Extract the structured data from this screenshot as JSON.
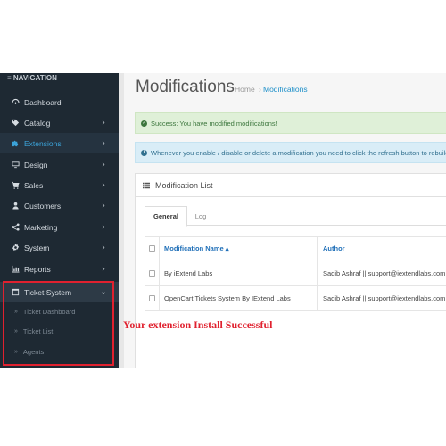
{
  "sidebar": {
    "heading": "≡ NAVIGATION",
    "items": [
      {
        "label": "Dashboard",
        "icon": "dashboard-icon",
        "has_arrow": false
      },
      {
        "label": "Catalog",
        "icon": "tag-icon",
        "has_arrow": true
      },
      {
        "label": "Extensions",
        "icon": "puzzle-icon",
        "has_arrow": true
      },
      {
        "label": "Design",
        "icon": "monitor-icon",
        "has_arrow": true
      },
      {
        "label": "Sales",
        "icon": "cart-icon",
        "has_arrow": true
      },
      {
        "label": "Customers",
        "icon": "user-icon",
        "has_arrow": true
      },
      {
        "label": "Marketing",
        "icon": "share-icon",
        "has_arrow": true
      },
      {
        "label": "System",
        "icon": "gear-icon",
        "has_arrow": true
      },
      {
        "label": "Reports",
        "icon": "bar-chart-icon",
        "has_arrow": true
      },
      {
        "label": "Ticket System",
        "icon": "ticket-icon",
        "has_arrow": true
      }
    ],
    "sub_items": [
      {
        "label": "Ticket Dashboard"
      },
      {
        "label": "Ticket List"
      },
      {
        "label": "Agents"
      }
    ],
    "chevron_right": "›",
    "chevron_down": "⌄",
    "sub_arrow": "»"
  },
  "header": {
    "title": "Modifications",
    "breadcrumb_home": "Home",
    "breadcrumb_sep": "›",
    "breadcrumb_current": "Modifications"
  },
  "alerts": {
    "success": "Success: You have modified modifications!",
    "success_icon": "check-circle-icon",
    "info": "Whenever you enable / disable or delete a modification you need to click the refresh button to rebuild",
    "info_icon": "info-circle-icon"
  },
  "panel": {
    "title": "Modification List",
    "icon": "list-icon",
    "tabs": [
      "General",
      "Log"
    ],
    "columns": [
      "Modification Name ▴",
      "Author"
    ],
    "rows": [
      {
        "name": "By iExtend Labs",
        "author": "Saqib Ashraf || support@iextendlabs.com"
      },
      {
        "name": "OpenCart Tickets System By IExtend Labs",
        "author": "Saqib Ashraf || support@iextendlabs.com"
      }
    ]
  },
  "annotation": {
    "callout": "Your extension Install Successful"
  },
  "colors": {
    "sidebar_bg": "#1e2933",
    "active_blue": "#3ba3d9",
    "highlight_red": "#e0212f",
    "success_bg": "#dff0d8",
    "info_bg": "#d9edf7"
  }
}
